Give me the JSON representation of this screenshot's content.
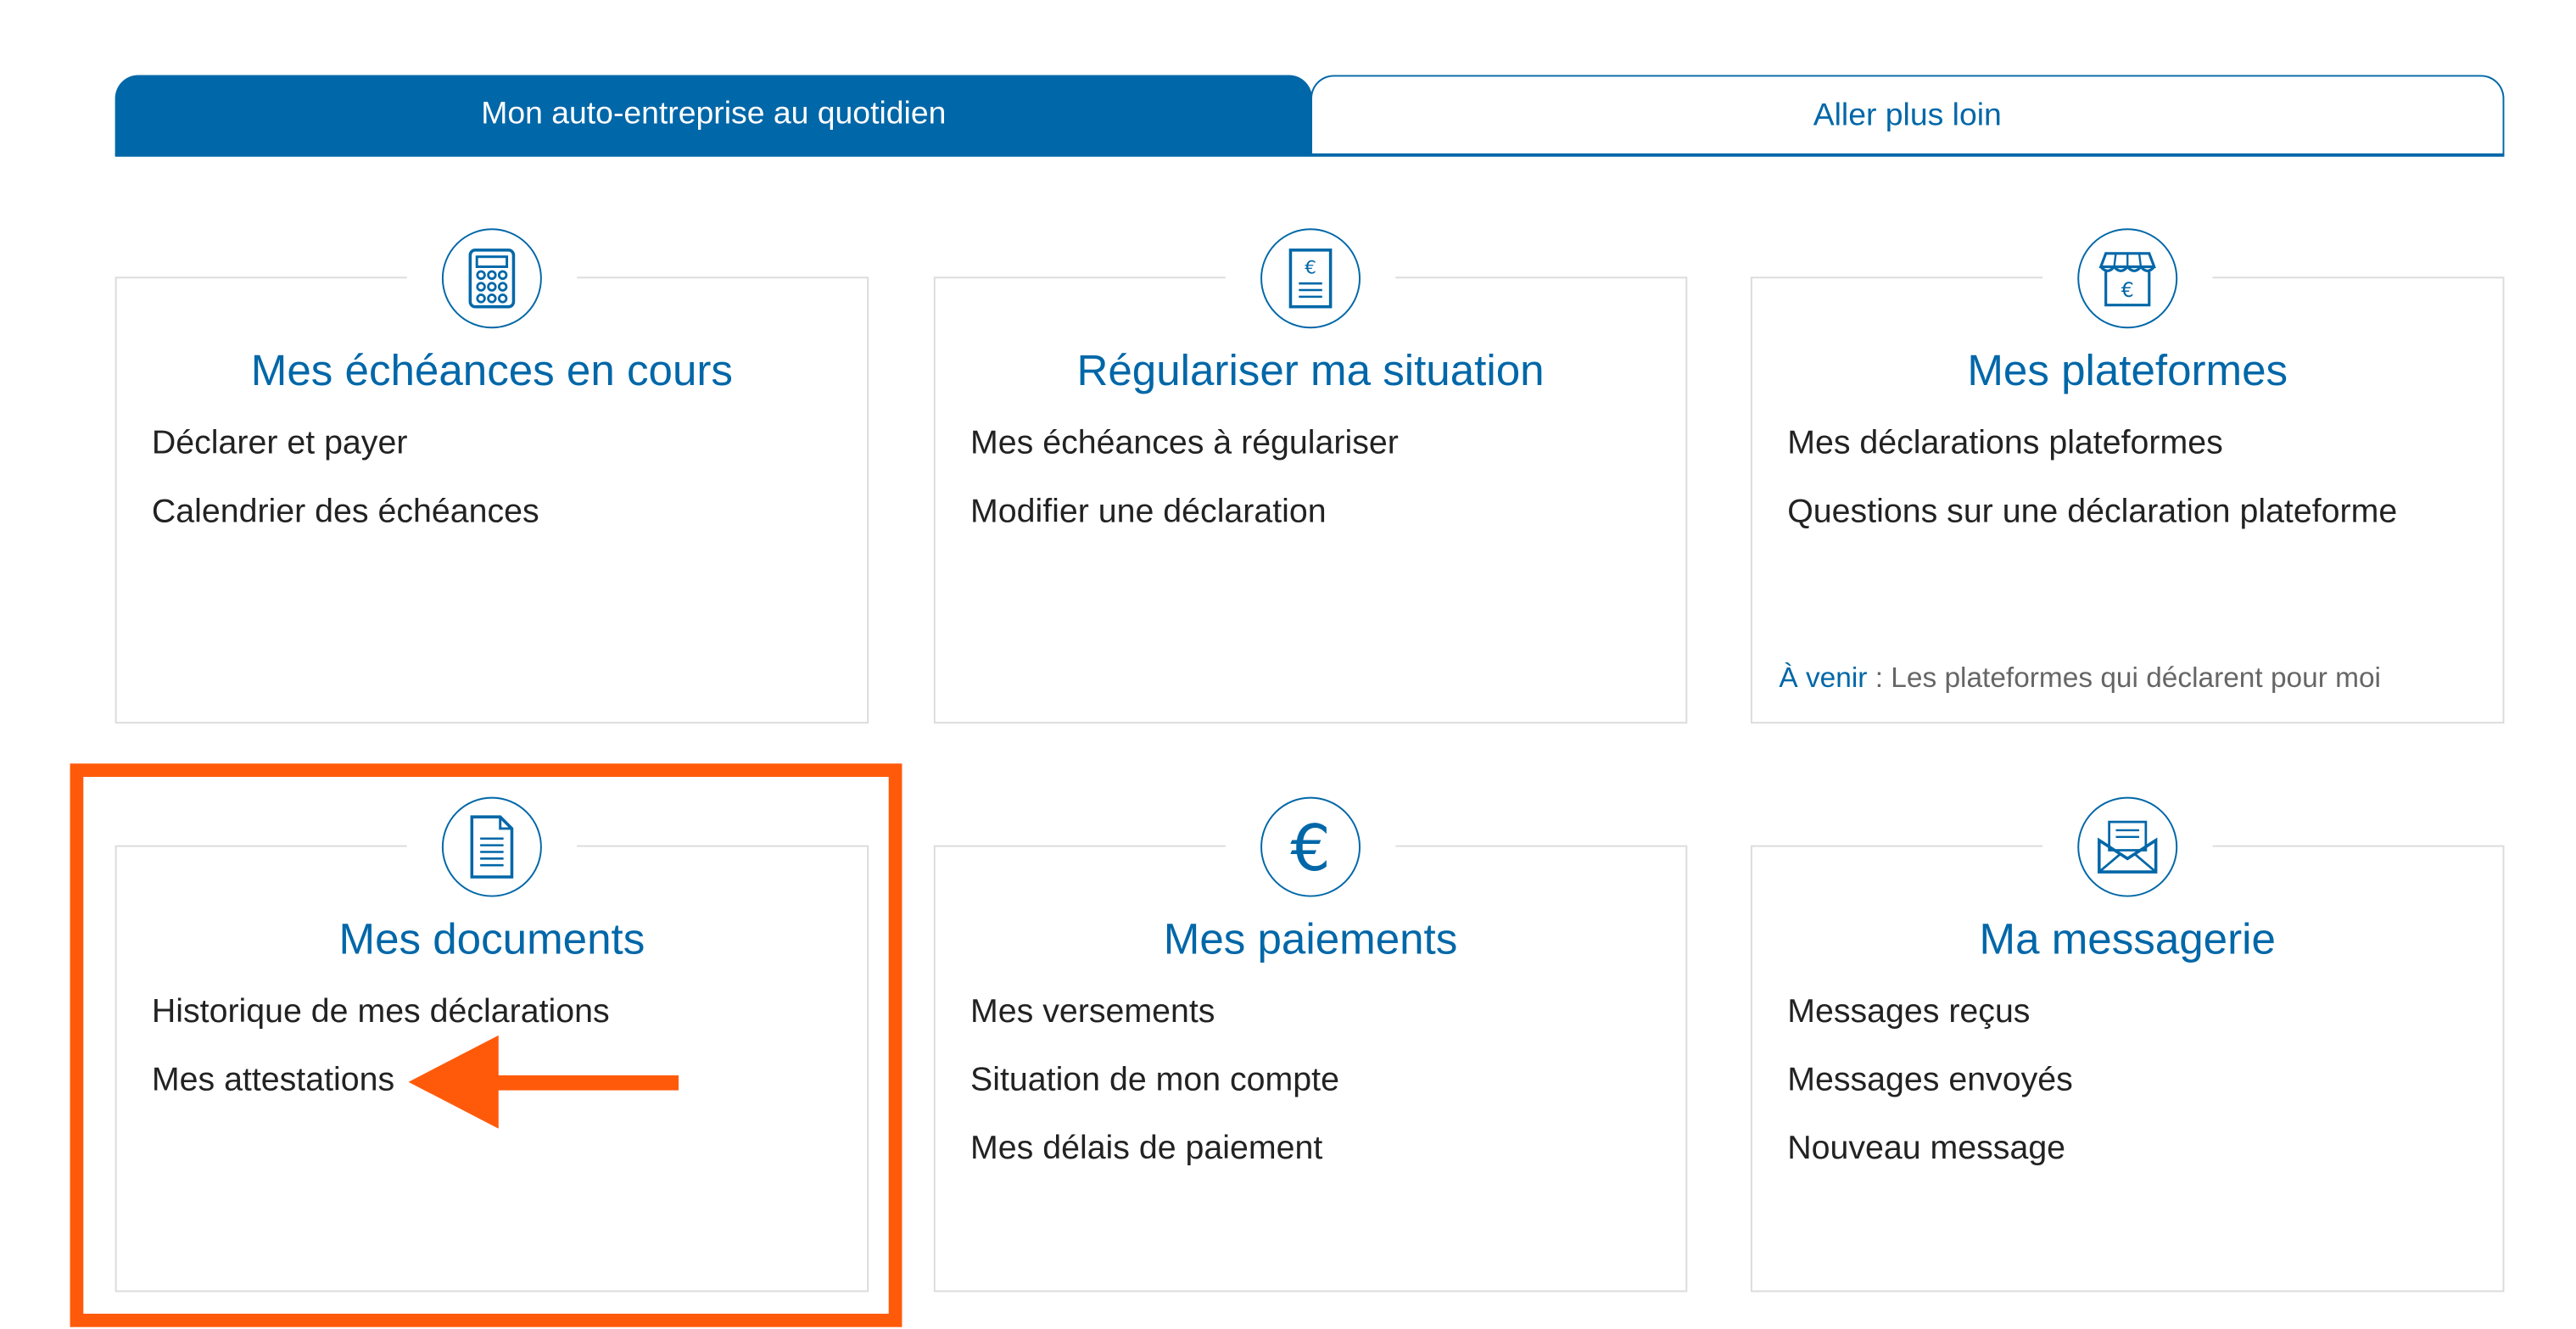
{
  "tabs": [
    {
      "label": "Mon auto-entreprise au quotidien",
      "active": true
    },
    {
      "label": "Aller plus loin",
      "active": false
    }
  ],
  "cards": [
    {
      "icon": "calculator-icon",
      "title": "Mes échéances en cours",
      "links": [
        "Déclarer et payer",
        "Calendrier des échéances"
      ]
    },
    {
      "icon": "euro-document-icon",
      "title": "Régulariser ma situation",
      "links": [
        "Mes échéances à régulariser",
        "Modifier une déclaration"
      ]
    },
    {
      "icon": "shop-euro-icon",
      "title": "Mes plateformes",
      "links": [
        "Mes déclarations plateformes",
        "Questions sur une déclaration plateforme"
      ],
      "note": {
        "label": "À venir",
        "separator": " : ",
        "text": "Les plateformes qui déclarent pour moi"
      }
    },
    {
      "icon": "document-icon",
      "title": "Mes documents",
      "links": [
        "Historique de mes déclarations",
        "Mes attestations"
      ]
    },
    {
      "icon": "euro-icon",
      "title": "Mes paiements",
      "links": [
        "Mes versements",
        "Situation de mon compte",
        "Mes délais de paiement"
      ]
    },
    {
      "icon": "envelope-icon",
      "title": "Ma messagerie",
      "links": [
        "Messages reçus",
        "Messages envoyés",
        "Nouveau message"
      ]
    }
  ],
  "colors": {
    "brand": "#0067a8",
    "highlight": "#ff5a0a",
    "text": "#222222"
  }
}
